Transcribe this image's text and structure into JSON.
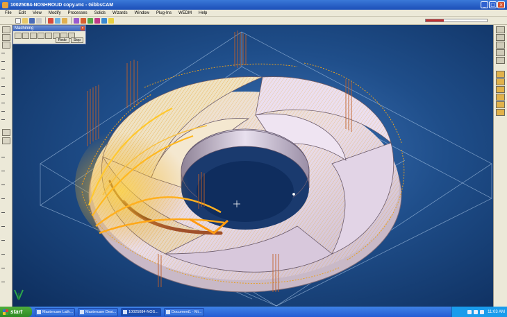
{
  "window": {
    "title": "10025084-NOSHROUD copy.vnc - GibbsCAM"
  },
  "menu": [
    "File",
    "Edit",
    "View",
    "Modify",
    "Processes",
    "Solids",
    "Wizards",
    "Window",
    "Plug-Ins",
    "WEDM",
    "Help"
  ],
  "machining_palette": {
    "title": "Machining",
    "buttons": [
      "Redo",
      "Stop"
    ]
  },
  "taskbar": {
    "start_label": "start",
    "tasks": [
      {
        "label": "Mastercam Lath..."
      },
      {
        "label": "Mastercam Desi..."
      },
      {
        "label": "10025084-NOS..."
      },
      {
        "label": "Document1 - Mi..."
      }
    ],
    "clock": "11:03 AM"
  },
  "colors": {
    "titlebar": "#1c4fb8",
    "viewport_bg": "#1f4e8a",
    "toolpath": "#e8a820",
    "part_surface": "#d8cfe0",
    "taskbar": "#245dd4",
    "start_button": "#2e8a24"
  }
}
